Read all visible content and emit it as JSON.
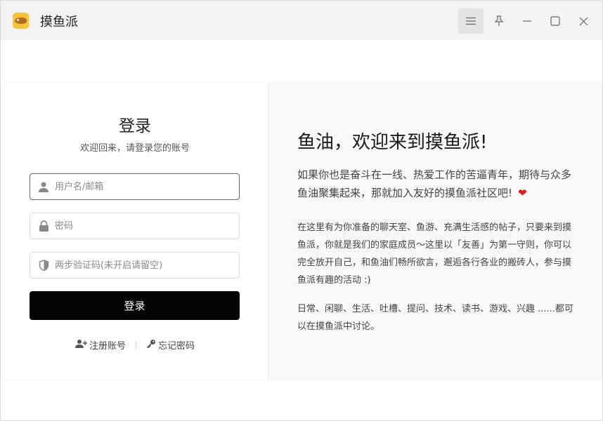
{
  "window": {
    "title": "摸鱼派",
    "controls": [
      "menu-icon",
      "pin-icon",
      "minimize-icon",
      "maximize-icon",
      "close-icon"
    ]
  },
  "login": {
    "title": "登录",
    "subtitle": "欢迎回来，请登录您的账号",
    "username_placeholder": "用户名/邮箱",
    "password_placeholder": "密码",
    "twofa_placeholder": "两步验证码(未开启请留空)",
    "submit_label": "登录",
    "register_label": "注册账号",
    "forgot_label": "忘记密码"
  },
  "welcome": {
    "title": "鱼油，欢迎来到摸鱼派!",
    "intro": "如果你也是奋斗在一线、热爱工作的苦逼青年，期待与众多鱼油聚集起来，那就加入友好的摸鱼派社区吧!",
    "heart": "❤",
    "para1": "在这里有为你准备的聊天室、鱼游、充满生活感的帖子，只要来到摸鱼派，你就是我们的家庭成员～这里以「友善」为第一守则，你可以完全放开自己，和鱼油们畅所欲言，邂逅各行各业的搬砖人，参与摸鱼派有趣的活动 :)",
    "para2": "日常、闲聊、生活、吐槽、提问、技术、读书、游戏、兴趣 ......都可以在摸鱼派中讨论。"
  },
  "colors": {
    "titlebar_bg": "#f3f3f3",
    "right_panel_bg": "#f8f8f8",
    "button_bg": "#050505",
    "heart": "#e0191e"
  }
}
